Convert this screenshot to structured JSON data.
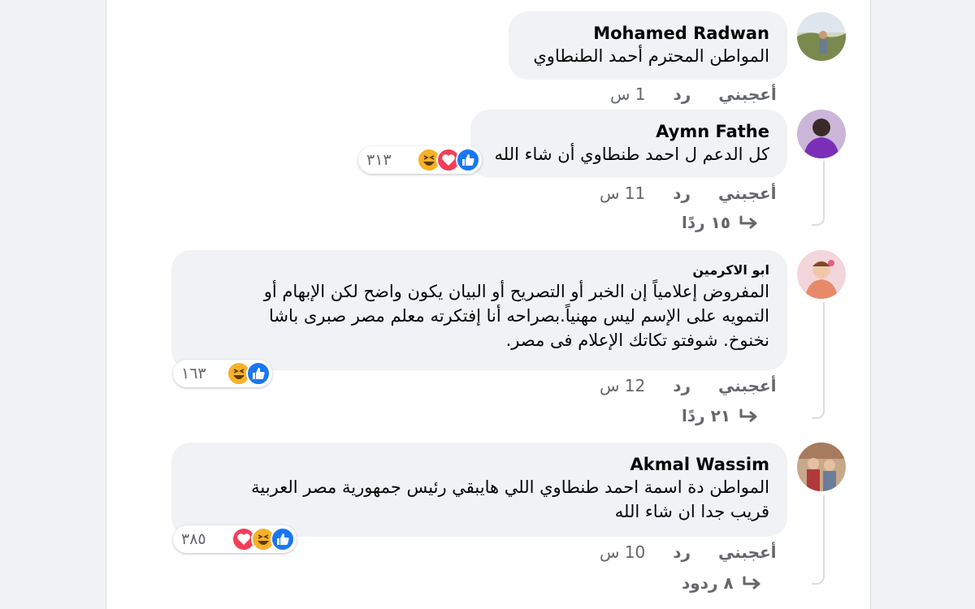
{
  "comments": [
    {
      "author": "Mohamed Radwan",
      "text": "المواطن المحترم أحمد الطنطاوي",
      "actions": {
        "like": "أعجبني",
        "reply": "رد",
        "time": "1 س"
      }
    },
    {
      "author": "Aymn Fathe",
      "text": "كل الدعم ل احمد طنطاوي أن شاء الله",
      "reaction_count": "٣١٣",
      "reaction_icons": [
        "like-icon",
        "love-icon",
        "haha-icon"
      ],
      "actions": {
        "like": "أعجبني",
        "reply": "رد",
        "time": "11 س"
      },
      "replies": "١٥ ردًا"
    },
    {
      "author": "ابو الاكرمين",
      "text_lines": [
        "المفروض إعلامياً إن الخبر أو التصريح أو البيان يكون واضح لكن الإبهام أو",
        "التمويه على الإسم ليس مهنياً.بصراحه أنا إفتكرته معلم مصر صبرى باشا",
        "نخنوخ. شوفتو تكاتك الإعلام فى مصر."
      ],
      "reaction_count": "١٦٣",
      "reaction_icons": [
        "like-icon",
        "haha-icon"
      ],
      "actions": {
        "like": "أعجبني",
        "reply": "رد",
        "time": "12 س"
      },
      "replies": "٢١ ردًا"
    },
    {
      "author": "Akmal Wassim",
      "text_lines": [
        "المواطن دة اسمة احمد طنطاوي اللي هايبقي رئيس جمهورية مصر العربية",
        "قريب جدا ان شاء الله"
      ],
      "reaction_count": "٣٨٥",
      "reaction_icons": [
        "like-icon",
        "haha-icon",
        "love-icon"
      ],
      "actions": {
        "like": "أعجبني",
        "reply": "رد",
        "time": "10 س"
      },
      "replies": "٨ ردود"
    }
  ],
  "colors": {
    "like": "#1877f2",
    "love": "#f33e58",
    "haha": "#f7b125",
    "bubble": "#f0f2f5",
    "secondary_text": "#65676b"
  }
}
